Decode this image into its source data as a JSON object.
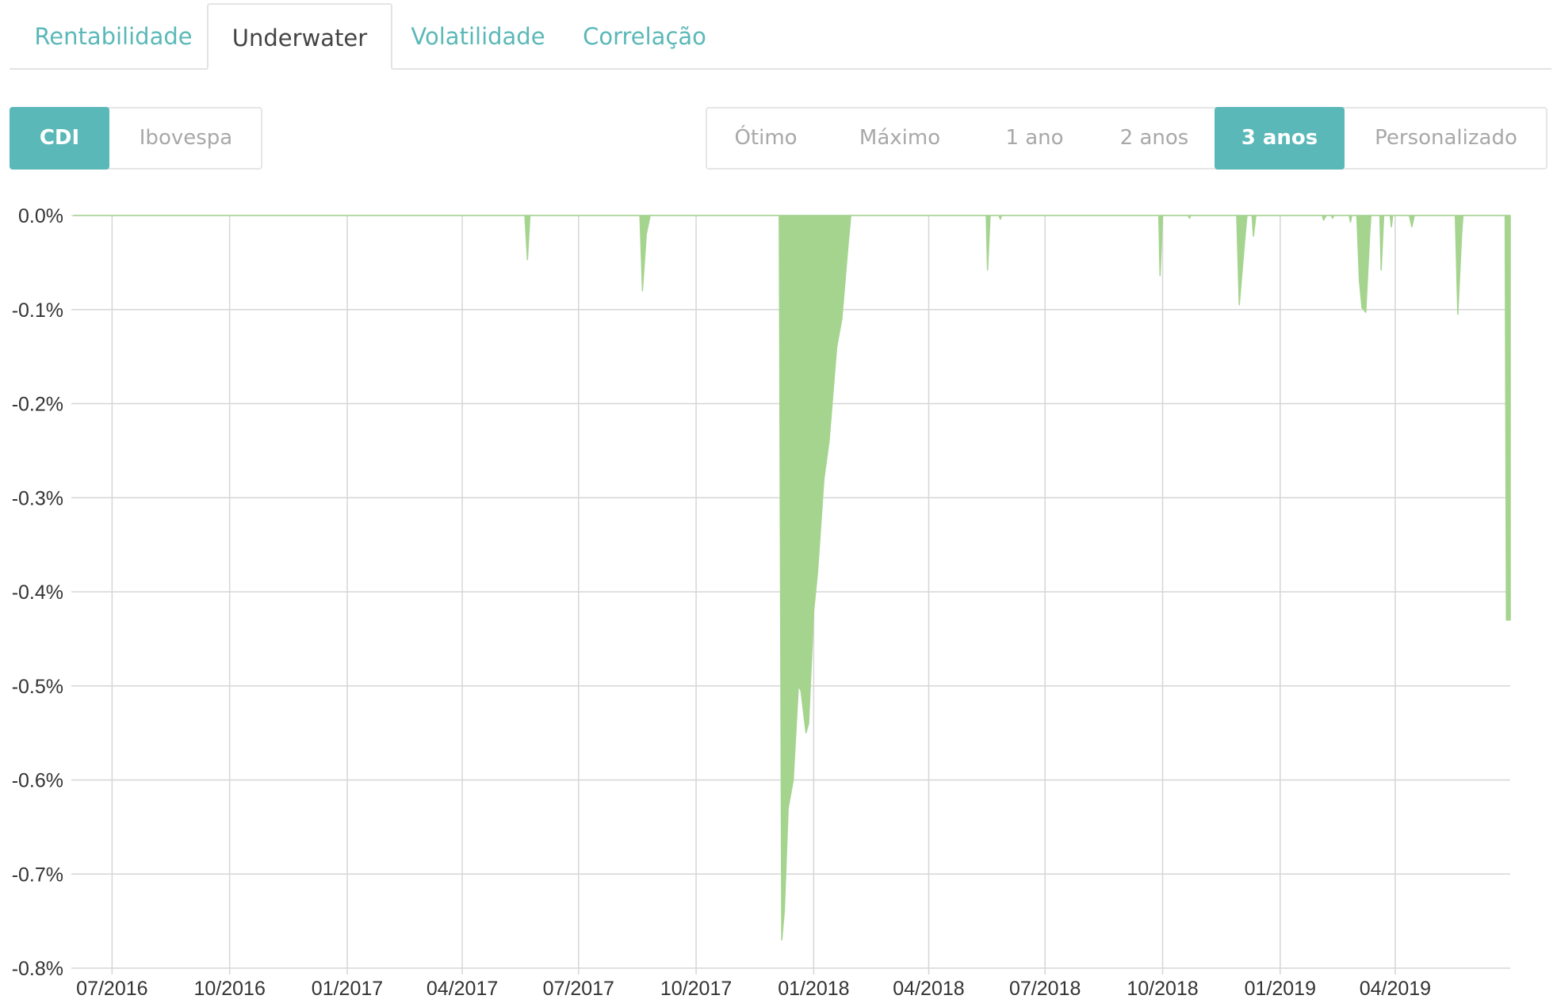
{
  "tabs": [
    {
      "label": "Rentabilidade",
      "active": false
    },
    {
      "label": "Underwater",
      "active": true
    },
    {
      "label": "Volatilidade",
      "active": false
    },
    {
      "label": "Correlação",
      "active": false
    }
  ],
  "benchmark": {
    "options": [
      "CDI",
      "Ibovespa"
    ],
    "selected": "CDI"
  },
  "period": {
    "options": [
      "Ótimo",
      "Máximo",
      "1 ano",
      "2 anos",
      "3 anos",
      "Personalizado"
    ],
    "selected": "3 anos"
  },
  "colors": {
    "accent": "#5bb8b8",
    "area_fill": "#a5d48f",
    "grid": "#d6d6d6"
  },
  "chart_data": {
    "type": "area",
    "x_ticks": [
      "07/2016",
      "10/2016",
      "01/2017",
      "04/2017",
      "07/2017",
      "10/2017",
      "01/2018",
      "04/2018",
      "07/2018",
      "10/2018",
      "01/2019",
      "04/2019"
    ],
    "y_ticks": [
      "0.0%",
      "-0.1%",
      "-0.2%",
      "-0.3%",
      "-0.4%",
      "-0.5%",
      "-0.6%",
      "-0.7%",
      "-0.8%"
    ],
    "ylim": [
      -0.8,
      0.0
    ],
    "xlim": [
      "2016-06-01",
      "2019-06-30"
    ],
    "grid": true,
    "series": [
      {
        "values": [
          [
            "2016-06-01",
            0.0
          ],
          [
            "2017-05-20",
            0.0
          ],
          [
            "2017-05-22",
            -0.047
          ],
          [
            "2017-05-24",
            0.0
          ],
          [
            "2017-08-18",
            0.0
          ],
          [
            "2017-08-20",
            -0.08
          ],
          [
            "2017-08-23",
            -0.02
          ],
          [
            "2017-08-26",
            0.0
          ],
          [
            "2017-12-05",
            0.0
          ],
          [
            "2017-12-07",
            -0.77
          ],
          [
            "2017-12-09",
            -0.74
          ],
          [
            "2017-12-12",
            -0.63
          ],
          [
            "2017-12-16",
            -0.6
          ],
          [
            "2017-12-20",
            -0.5
          ],
          [
            "2017-12-22",
            -0.505
          ],
          [
            "2017-12-26",
            -0.55
          ],
          [
            "2017-12-28",
            -0.54
          ],
          [
            "2018-01-01",
            -0.42
          ],
          [
            "2018-01-04",
            -0.38
          ],
          [
            "2018-01-09",
            -0.28
          ],
          [
            "2018-01-13",
            -0.24
          ],
          [
            "2018-01-19",
            -0.14
          ],
          [
            "2018-01-23",
            -0.11
          ],
          [
            "2018-01-28",
            -0.03
          ],
          [
            "2018-01-30",
            0.0
          ],
          [
            "2018-05-16",
            0.0
          ],
          [
            "2018-05-17",
            -0.058
          ],
          [
            "2018-05-19",
            0.0
          ],
          [
            "2018-05-26",
            0.0
          ],
          [
            "2018-05-27",
            -0.004
          ],
          [
            "2018-05-28",
            0.0
          ],
          [
            "2018-09-28",
            0.0
          ],
          [
            "2018-09-29",
            -0.064
          ],
          [
            "2018-10-01",
            0.0
          ],
          [
            "2018-10-21",
            0.0
          ],
          [
            "2018-10-22",
            -0.003
          ],
          [
            "2018-10-23",
            0.0
          ],
          [
            "2018-11-28",
            0.0
          ],
          [
            "2018-11-30",
            -0.095
          ],
          [
            "2018-12-04",
            -0.03
          ],
          [
            "2018-12-06",
            0.0
          ],
          [
            "2018-12-10",
            0.0
          ],
          [
            "2018-12-11",
            -0.022
          ],
          [
            "2018-12-13",
            0.0
          ],
          [
            "2019-02-03",
            0.0
          ],
          [
            "2019-02-04",
            -0.005
          ],
          [
            "2019-02-06",
            0.0
          ],
          [
            "2019-02-10",
            0.0
          ],
          [
            "2019-02-11",
            -0.003
          ],
          [
            "2019-02-12",
            0.0
          ],
          [
            "2019-02-24",
            0.0
          ],
          [
            "2019-02-25",
            -0.007
          ],
          [
            "2019-02-26",
            0.0
          ],
          [
            "2019-03-02",
            0.0
          ],
          [
            "2019-03-04",
            -0.07
          ],
          [
            "2019-03-06",
            -0.098
          ],
          [
            "2019-03-09",
            -0.103
          ],
          [
            "2019-03-12",
            -0.02
          ],
          [
            "2019-03-13",
            0.0
          ],
          [
            "2019-03-20",
            0.0
          ],
          [
            "2019-03-21",
            -0.058
          ],
          [
            "2019-03-23",
            0.0
          ],
          [
            "2019-03-28",
            0.0
          ],
          [
            "2019-03-29",
            -0.012
          ],
          [
            "2019-03-30",
            0.0
          ],
          [
            "2019-04-12",
            0.0
          ],
          [
            "2019-04-14",
            -0.012
          ],
          [
            "2019-04-16",
            0.0
          ],
          [
            "2019-05-18",
            0.0
          ],
          [
            "2019-05-20",
            -0.105
          ],
          [
            "2019-05-23",
            -0.02
          ],
          [
            "2019-05-24",
            0.0
          ],
          [
            "2019-06-26",
            0.0
          ],
          [
            "2019-06-27",
            -0.43
          ],
          [
            "2019-06-30",
            -0.43
          ]
        ]
      }
    ]
  }
}
